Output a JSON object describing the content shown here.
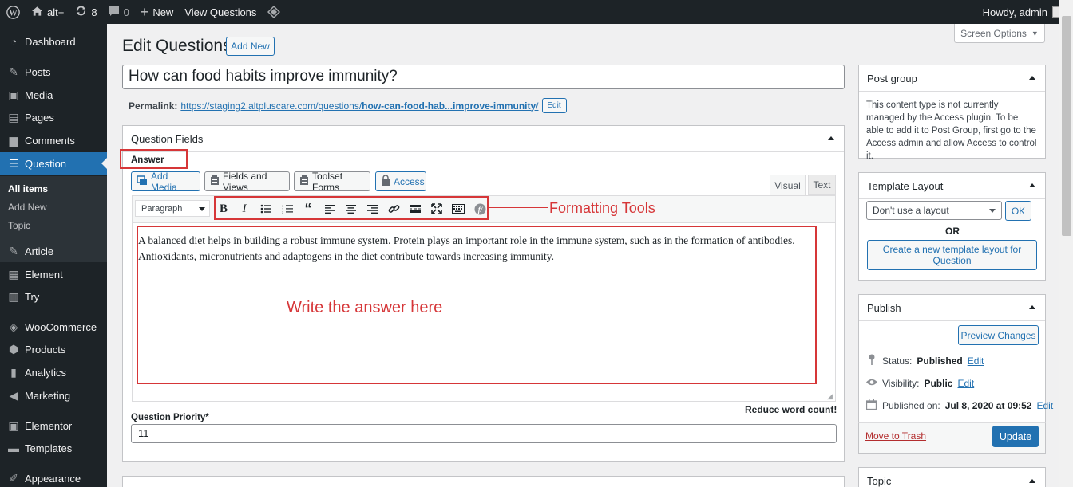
{
  "adminbar": {
    "site_name": "alt+",
    "updates_count": "8",
    "comments_count": "0",
    "new_label": "New",
    "view_label": "View Questions",
    "howdy": "Howdy, admin"
  },
  "menu": {
    "items": [
      {
        "label": "Dashboard",
        "icon": "dashboard-icon"
      },
      {
        "label": "Posts",
        "icon": "pin-icon"
      },
      {
        "label": "Media",
        "icon": "media-icon"
      },
      {
        "label": "Pages",
        "icon": "pages-icon"
      },
      {
        "label": "Comments",
        "icon": "comments-icon"
      },
      {
        "label": "Question",
        "icon": "list-icon"
      },
      {
        "label": "Article",
        "icon": "edit-icon"
      },
      {
        "label": "Element",
        "icon": "element-icon"
      },
      {
        "label": "Try",
        "icon": "try-icon"
      },
      {
        "label": "WooCommerce",
        "icon": "woocommerce-icon"
      },
      {
        "label": "Products",
        "icon": "box-icon"
      },
      {
        "label": "Analytics",
        "icon": "bar-chart-icon"
      },
      {
        "label": "Marketing",
        "icon": "megaphone-icon"
      },
      {
        "label": "Elementor",
        "icon": "elementor-icon"
      },
      {
        "label": "Templates",
        "icon": "folder-icon"
      },
      {
        "label": "Appearance",
        "icon": "brush-icon"
      }
    ],
    "submenu": [
      "All items",
      "Add New",
      "Topic"
    ]
  },
  "header": {
    "title": "Edit Questions",
    "add_new": "Add New",
    "screen_options": "Screen Options"
  },
  "post": {
    "title": "How can food habits improve immunity?",
    "permalink_label": "Permalink:",
    "permalink_base": "https://staging2.altpluscare.com/questions/",
    "permalink_slug": "how-can-food-hab...improve-immunity",
    "permalink_end": "/",
    "edit_label": "Edit"
  },
  "question_fields": {
    "title": "Question Fields",
    "answer_label": "Answer",
    "buttons": [
      "Add Media",
      "Fields and Views",
      "Toolset Forms",
      "Access"
    ],
    "tab_visual": "Visual",
    "tab_text": "Text",
    "paragraph": "Paragraph",
    "content": "A balanced diet helps in building a robust immune system. Protein plays an important role in the immune system, such as in the formation of antibodies. Antioxidants, micronutrients and adaptogens in the diet contribute towards increasing immunity.",
    "reduce_word_count": "Reduce word count!",
    "priority_label": "Question Priority*",
    "priority_value": "11"
  },
  "annotations": {
    "formatting_tools": "Formatting Tools",
    "write_answer": "Write the answer here",
    "color": "#d63638"
  },
  "post_group": {
    "title": "Post group",
    "text": "This content type is not currently managed by the Access plugin. To be able to add it to Post Group, first go to the Access admin and allow Access to control it."
  },
  "template_layout": {
    "title": "Template Layout",
    "select_value": "Don't use a layout",
    "ok": "OK",
    "or": "OR",
    "create_button": "Create a new template layout for Question"
  },
  "publish": {
    "title": "Publish",
    "preview": "Preview Changes",
    "status_label": "Status:",
    "status_value": "Published",
    "visibility_label": "Visibility:",
    "visibility_value": "Public",
    "published_label": "Published on:",
    "published_value": "Jul 8, 2020 at 09:52",
    "edit": "Edit",
    "trash": "Move to Trash",
    "update": "Update"
  },
  "topic": {
    "title": "Topic"
  }
}
